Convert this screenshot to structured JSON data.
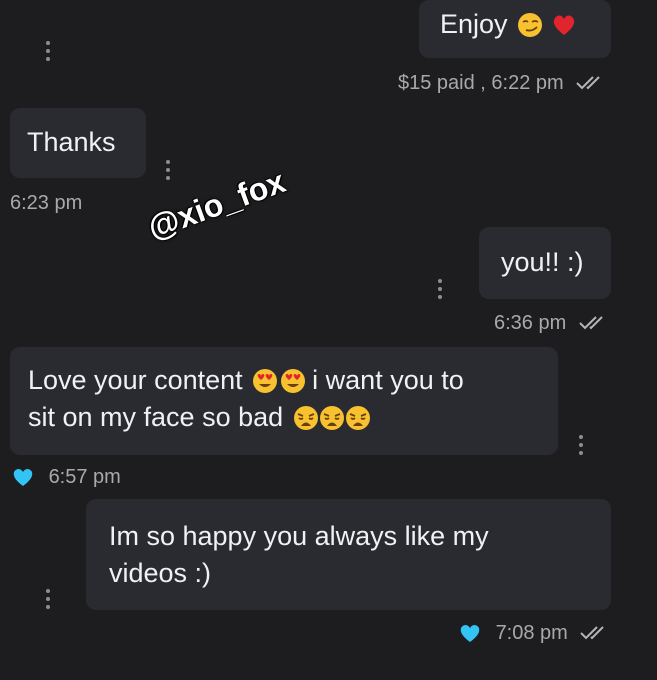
{
  "messages": [
    {
      "text": "Enjoy",
      "meta": "$15 paid , 6:22 pm"
    },
    {
      "text": "Thanks",
      "meta": "6:23 pm"
    },
    {
      "text": "you!! :)",
      "meta": "6:36 pm"
    },
    {
      "text_line1": "Love your content",
      "text_line1b": "i want you to",
      "text_line2": "sit on my face so bad",
      "meta": "6:57 pm"
    },
    {
      "text_line1": "Im so happy you always like my",
      "text_line2": "videos :)",
      "meta": "7:08 pm"
    }
  ],
  "watermark": "@xio_fox",
  "colors": {
    "background": "#1d1d1f",
    "bubble": "#2a2b30",
    "meta_text": "#a9a9ad",
    "like_heart": "#34c3f5",
    "red_heart": "#e1252e"
  },
  "icons": [
    "more-vertical-icon",
    "double-check-icon",
    "heart-icon",
    "smirk-emoji",
    "heart-eyes-emoji",
    "weary-emoji"
  ]
}
